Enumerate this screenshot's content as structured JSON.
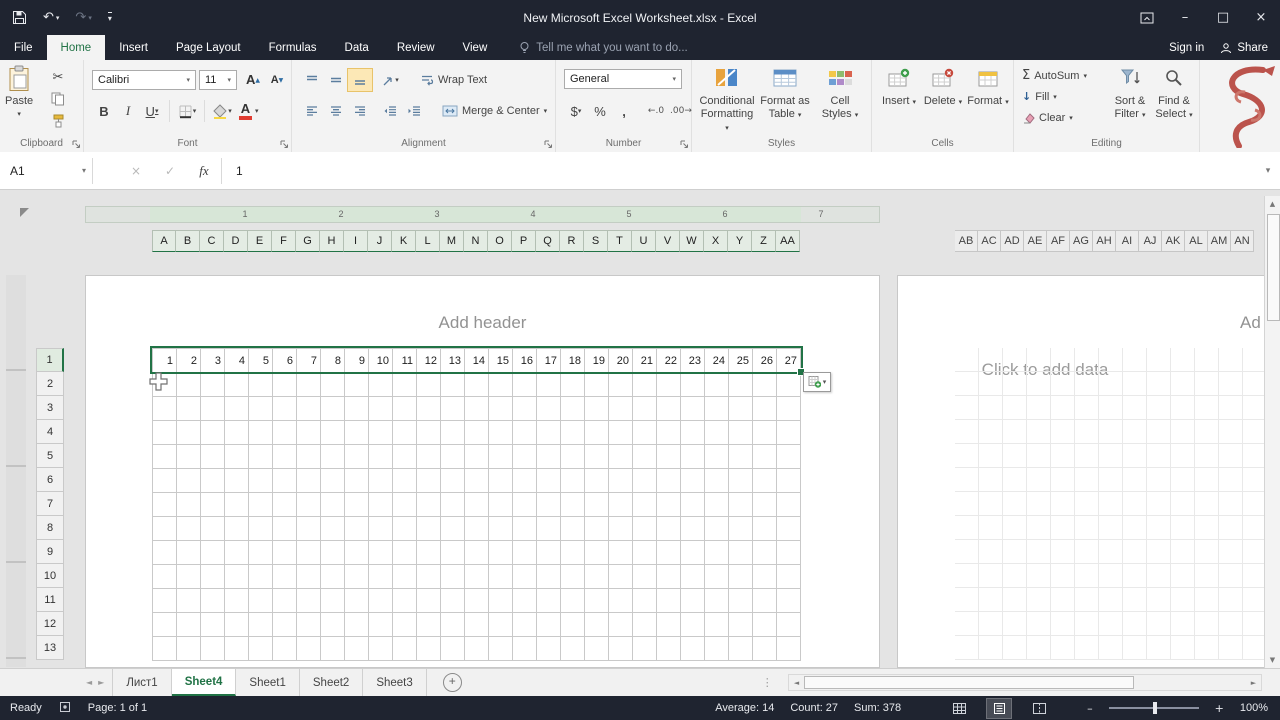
{
  "colors": {
    "accent_green": "#217346",
    "dark_bar": "#1f2430",
    "ribbon_bg": "#f3f3f3",
    "selection_green": "#217346"
  },
  "title_bar": {
    "title": "New Microsoft Excel Worksheet.xlsx - Excel"
  },
  "glyphs": {
    "undo": "↶",
    "redo": "↷",
    "cut": "✂",
    "bold": "B",
    "italic": "I",
    "underline": "U",
    "currency": "$",
    "percent": "%",
    "comma": ",",
    "inc_decimal": "←.0",
    "dec_decimal": ".00→",
    "autosum": "Σ",
    "fill_arrow": "↓",
    "minimize": "–",
    "maximize": "□",
    "close": "×",
    "cancel": "×",
    "check": "✓",
    "fx": "fx",
    "arrow_down": "▾",
    "arrow_up": "▲",
    "arrow_down_small": "▼",
    "scroll_left": "◄",
    "scroll_right": "►",
    "splitter": "⋮",
    "add_sheet": "+",
    "zoom_out": "–",
    "zoom_in": "+",
    "grow_font": "A",
    "shrink_font": "A"
  },
  "tabs": {
    "items": [
      "File",
      "Home",
      "Insert",
      "Page Layout",
      "Formulas",
      "Data",
      "Review",
      "View"
    ],
    "active": "Home",
    "tell_me": "Tell me what you want to do...",
    "sign_in": "Sign in",
    "share": "Share"
  },
  "ribbon": {
    "clipboard": {
      "label": "Clipboard",
      "paste": "Paste"
    },
    "font": {
      "label": "Font",
      "family": "Calibri",
      "size": "11"
    },
    "alignment": {
      "label": "Alignment",
      "wrap_text": "Wrap Text",
      "merge_center": "Merge & Center"
    },
    "number": {
      "label": "Number",
      "format": "General"
    },
    "styles": {
      "label": "Styles",
      "conditional_line1": "Conditional",
      "conditional_line2": "Formatting",
      "table_line1": "Format as",
      "table_line2": "Table",
      "cellstyles_line1": "Cell",
      "cellstyles_line2": "Styles"
    },
    "cells": {
      "label": "Cells",
      "insert": "Insert",
      "delete": "Delete",
      "format": "Format"
    },
    "editing": {
      "label": "Editing",
      "autosum": "AutoSum",
      "fill": "Fill",
      "clear": "Clear",
      "sort_line1": "Sort &",
      "sort_line2": "Filter",
      "find_line1": "Find &",
      "find_line2": "Select"
    }
  },
  "formula_bar": {
    "name_box": "A1",
    "content": "1"
  },
  "sheet": {
    "header_placeholder": "Add header",
    "header_placeholder_right": "Ad",
    "data_placeholder": "Click to add data",
    "ruler_numbers": [
      1,
      2,
      3,
      4,
      5,
      6,
      7
    ],
    "columns_left": [
      "A",
      "B",
      "C",
      "D",
      "E",
      "F",
      "G",
      "H",
      "I",
      "J",
      "K",
      "L",
      "M",
      "N",
      "O",
      "P",
      "Q",
      "R",
      "S",
      "T",
      "U",
      "V",
      "W",
      "X",
      "Y",
      "Z",
      "AA"
    ],
    "columns_right": [
      "AB",
      "AC",
      "AD",
      "AE",
      "AF",
      "AG",
      "AH",
      "AI",
      "AJ",
      "AK",
      "AL",
      "AM",
      "AN"
    ],
    "rows": [
      "1",
      "2",
      "3",
      "4",
      "5",
      "6",
      "7",
      "8",
      "9",
      "10",
      "11",
      "12",
      "13"
    ],
    "row1_values": [
      1,
      2,
      3,
      4,
      5,
      6,
      7,
      8,
      9,
      10,
      11,
      12,
      13,
      14,
      15,
      16,
      17,
      18,
      19,
      20,
      21,
      22,
      23,
      24,
      25,
      26,
      27
    ]
  },
  "sheet_tabs": {
    "tabs": [
      "Лист1",
      "Sheet4",
      "Sheet1",
      "Sheet2",
      "Sheet3"
    ],
    "active": "Sheet4"
  },
  "status_bar": {
    "ready": "Ready",
    "page_info": "Page: 1 of 1",
    "average": "Average: 14",
    "count": "Count: 27",
    "sum": "Sum: 378",
    "zoom_level": "100%"
  }
}
